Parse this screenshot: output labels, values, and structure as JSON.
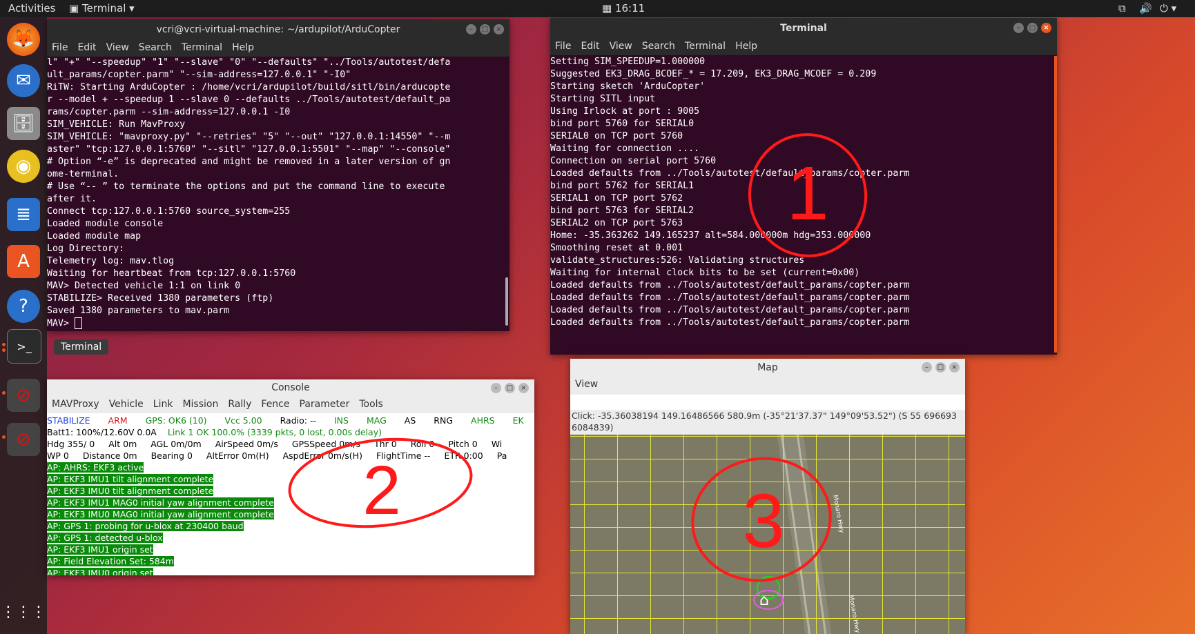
{
  "topbar": {
    "activities": "Activities",
    "app": "Terminal",
    "clock": "16:11"
  },
  "left_terminal": {
    "title": "vcri@vcri-virtual-machine: ~/ardupilot/ArduCopter",
    "menu": [
      "File",
      "Edit",
      "View",
      "Search",
      "Terminal",
      "Help"
    ],
    "lines": [
      "l\" \"+\" \"--speedup\" \"1\" \"--slave\" \"0\" \"--defaults\" \"../Tools/autotest/defa",
      "ult_params/copter.parm\" \"--sim-address=127.0.0.1\" \"-I0\"",
      "RiTW: Starting ArduCopter : /home/vcri/ardupilot/build/sitl/bin/arducopte",
      "r --model + --speedup 1 --slave 0 --defaults ../Tools/autotest/default_pa",
      "rams/copter.parm --sim-address=127.0.0.1 -I0",
      "SIM_VEHICLE: Run MavProxy",
      "SIM_VEHICLE: \"mavproxy.py\" \"--retries\" \"5\" \"--out\" \"127.0.0.1:14550\" \"--m",
      "aster\" \"tcp:127.0.0.1:5760\" \"--sitl\" \"127.0.0.1:5501\" \"--map\" \"--console\"",
      "# Option “-e” is deprecated and might be removed in a later version of gn",
      "ome-terminal.",
      "# Use “-- ” to terminate the options and put the command line to execute",
      "after it.",
      "Connect tcp:127.0.0.1:5760 source_system=255",
      "Loaded module console",
      "Loaded module map",
      "Log Directory:",
      "Telemetry log: mav.tlog",
      "Waiting for heartbeat from tcp:127.0.0.1:5760",
      "MAV> Detected vehicle 1:1 on link 0",
      "STABILIZE> Received 1380 parameters (ftp)",
      "Saved 1380 parameters to mav.parm",
      "MAV> "
    ]
  },
  "dock_tooltip": "Terminal",
  "right_terminal": {
    "title": "Terminal",
    "menu": [
      "File",
      "Edit",
      "View",
      "Search",
      "Terminal",
      "Help"
    ],
    "lines": [
      "Setting SIM_SPEEDUP=1.000000",
      "Suggested EK3_DRAG_BCOEF_* = 17.209, EK3_DRAG_MCOEF = 0.209",
      "Starting sketch 'ArduCopter'",
      "Starting SITL input",
      "Using Irlock at port : 9005",
      "bind port 5760 for SERIAL0",
      "SERIAL0 on TCP port 5760",
      "Waiting for connection ....",
      "Connection on serial port 5760",
      "Loaded defaults from ../Tools/autotest/default_params/copter.parm",
      "bind port 5762 for SERIAL1",
      "SERIAL1 on TCP port 5762",
      "bind port 5763 for SERIAL2",
      "SERIAL2 on TCP port 5763",
      "Home: -35.363262 149.165237 alt=584.000000m hdg=353.000000",
      "Smoothing reset at 0.001",
      "validate_structures:526: Validating structures",
      "Waiting for internal clock bits to be set (current=0x00)",
      "Loaded defaults from ../Tools/autotest/default_params/copter.parm",
      "Loaded defaults from ../Tools/autotest/default_params/copter.parm",
      "Loaded defaults from ../Tools/autotest/default_params/copter.parm",
      "Loaded defaults from ../Tools/autotest/default_params/copter.parm"
    ]
  },
  "console": {
    "title": "Console",
    "menu": [
      "MAVProxy",
      "Vehicle",
      "Link",
      "Mission",
      "Rally",
      "Fence",
      "Parameter",
      "Tools"
    ],
    "status_row1": [
      {
        "t": "STABILIZE",
        "c": "#1a3cdc"
      },
      {
        "t": "ARM",
        "c": "#e01010"
      },
      {
        "t": "GPS: OK6 (10)",
        "c": "#108a10"
      },
      {
        "t": "Vcc 5.00",
        "c": "#108a10"
      },
      {
        "t": "Radio: --",
        "c": "#000000"
      },
      {
        "t": "INS",
        "c": "#108a10"
      },
      {
        "t": "MAG",
        "c": "#108a10"
      },
      {
        "t": "AS",
        "c": "#000000"
      },
      {
        "t": "RNG",
        "c": "#000000"
      },
      {
        "t": "AHRS",
        "c": "#108a10"
      },
      {
        "t": "EK",
        "c": "#108a10"
      }
    ],
    "status_row2": [
      {
        "t": "Batt1: 100%/12.60V 0.0A",
        "c": "#000000"
      },
      {
        "t": "Link 1 OK 100.0% (3339 pkts, 0 lost, 0.00s delay)",
        "c": "#108a10"
      }
    ],
    "status_row3": [
      "Hdg 355/ 0",
      "Alt 0m",
      "AGL 0m/0m",
      "AirSpeed 0m/s",
      "GPSSpeed 0m/s",
      "Thr 0",
      "Roll 0",
      "Pitch 0",
      "Wi"
    ],
    "status_row4": [
      "WP 0",
      "Distance 0m",
      "Bearing 0",
      "AltError 0m(H)",
      "AspdError 0m/s(H)",
      "FlightTime --",
      "ETR 0:00",
      "Pa"
    ],
    "log": [
      "AP: AHRS: EKF3 active",
      "AP: EKF3 IMU1 tilt alignment complete",
      "AP: EKF3 IMU0 tilt alignment complete",
      "AP: EKF3 IMU1 MAG0 initial yaw alignment complete",
      "AP: EKF3 IMU0 MAG0 initial yaw alignment complete",
      "AP: GPS 1: probing for u-blox at 230400 baud",
      "AP: GPS 1: detected u-blox",
      "AP: EKF3 IMU1 origin set",
      "AP: Field Elevation Set: 584m",
      "AP: EKF3 IMU0 origin set"
    ]
  },
  "map": {
    "title": "Map",
    "menu": [
      "View"
    ],
    "click_info": "Click: -35.36038194 149.16486566  580.9m (-35°21'37.37\" 149°09'53.52\") (S 55 696693 6084839)",
    "road_label": "Monaro Hwy"
  },
  "annotations": {
    "a1": "1",
    "a2": "2",
    "a3": "3"
  },
  "colors": {
    "terminal_bg": "#300a24",
    "title_bar": "#2b2b2b",
    "ubuntu_orange": "#e95420",
    "grid": "#e6e635"
  }
}
